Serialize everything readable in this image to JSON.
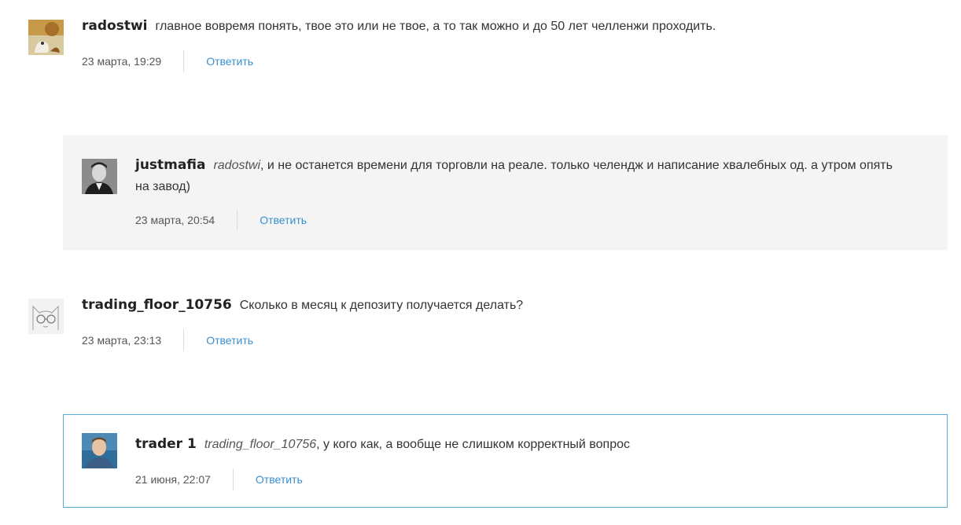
{
  "comments": [
    {
      "author": "radostwi",
      "mention": "",
      "text": "главное вовремя понять, твое это или не твое, а то так можно и до 50 лет челленжи проходить.",
      "date": "23 марта, 19:29",
      "reply_label": "Ответить",
      "avatar_icon": "squirrel-avatar-icon"
    },
    {
      "author": "justmafia",
      "mention": "radostwi",
      "text": ", и не останется времени для торговли на реале. только челендж и написание хвалебных од. а утром опять",
      "text_cont": "на завод)",
      "date": "23 марта, 20:54",
      "reply_label": "Ответить",
      "avatar_icon": "man-photo-avatar-icon"
    },
    {
      "author": "trading_floor_10756",
      "mention": "",
      "text": "Сколько в месяц к депозиту получается делать?",
      "date": "23 марта, 23:13",
      "reply_label": "Ответить",
      "avatar_icon": "cat-glasses-avatar-icon"
    },
    {
      "author": "trader 1",
      "mention": "trading_floor_10756",
      "text": ", у кого как, а вообще не слишком корректный вопрос",
      "date": "21 июня, 22:07",
      "reply_label": "Ответить",
      "avatar_icon": "person-photo-avatar-icon"
    }
  ],
  "colors": {
    "link": "#3a8fd0",
    "reply_bg": "#f4f4f4",
    "highlight_border": "#5aaad6"
  }
}
